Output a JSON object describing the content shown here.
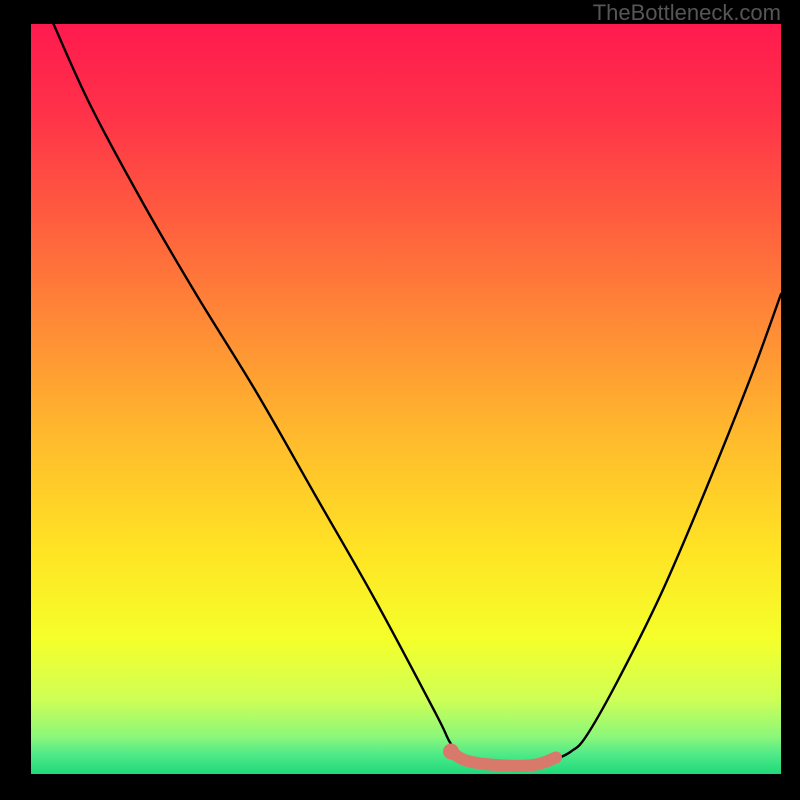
{
  "watermark": "TheBottleneck.com",
  "chart_data": {
    "type": "line",
    "title": "",
    "xlabel": "",
    "ylabel": "",
    "xlim": [
      0,
      100
    ],
    "ylim": [
      0,
      100
    ],
    "series": [
      {
        "name": "bottleneck-curve",
        "x": [
          3,
          8,
          15,
          22,
          30,
          38,
          46,
          54,
          56,
          58,
          62,
          67,
          70,
          72,
          74,
          78,
          84,
          90,
          96,
          100
        ],
        "y": [
          100,
          89,
          76,
          64,
          51,
          37,
          23,
          8,
          4,
          2,
          1,
          1,
          2,
          3,
          5,
          12,
          24,
          38,
          53,
          64
        ],
        "color": "#000000"
      },
      {
        "name": "highlight-segment",
        "x": [
          56,
          58,
          62,
          67,
          70
        ],
        "y": [
          3,
          1.8,
          1.2,
          1.2,
          2.2
        ],
        "color": "#d9796b"
      }
    ],
    "highlight_dot": {
      "x": 56,
      "y": 3,
      "color": "#d9796b"
    },
    "gradient_stops": [
      {
        "offset": 0.0,
        "color": "#ff1a4e"
      },
      {
        "offset": 0.12,
        "color": "#ff3249"
      },
      {
        "offset": 0.25,
        "color": "#ff5a3f"
      },
      {
        "offset": 0.4,
        "color": "#ff8a36"
      },
      {
        "offset": 0.55,
        "color": "#ffba2d"
      },
      {
        "offset": 0.7,
        "color": "#ffe324"
      },
      {
        "offset": 0.82,
        "color": "#f5ff2a"
      },
      {
        "offset": 0.9,
        "color": "#cfff55"
      },
      {
        "offset": 0.95,
        "color": "#8cf77a"
      },
      {
        "offset": 0.975,
        "color": "#4de988"
      },
      {
        "offset": 1.0,
        "color": "#1fd97a"
      }
    ]
  }
}
